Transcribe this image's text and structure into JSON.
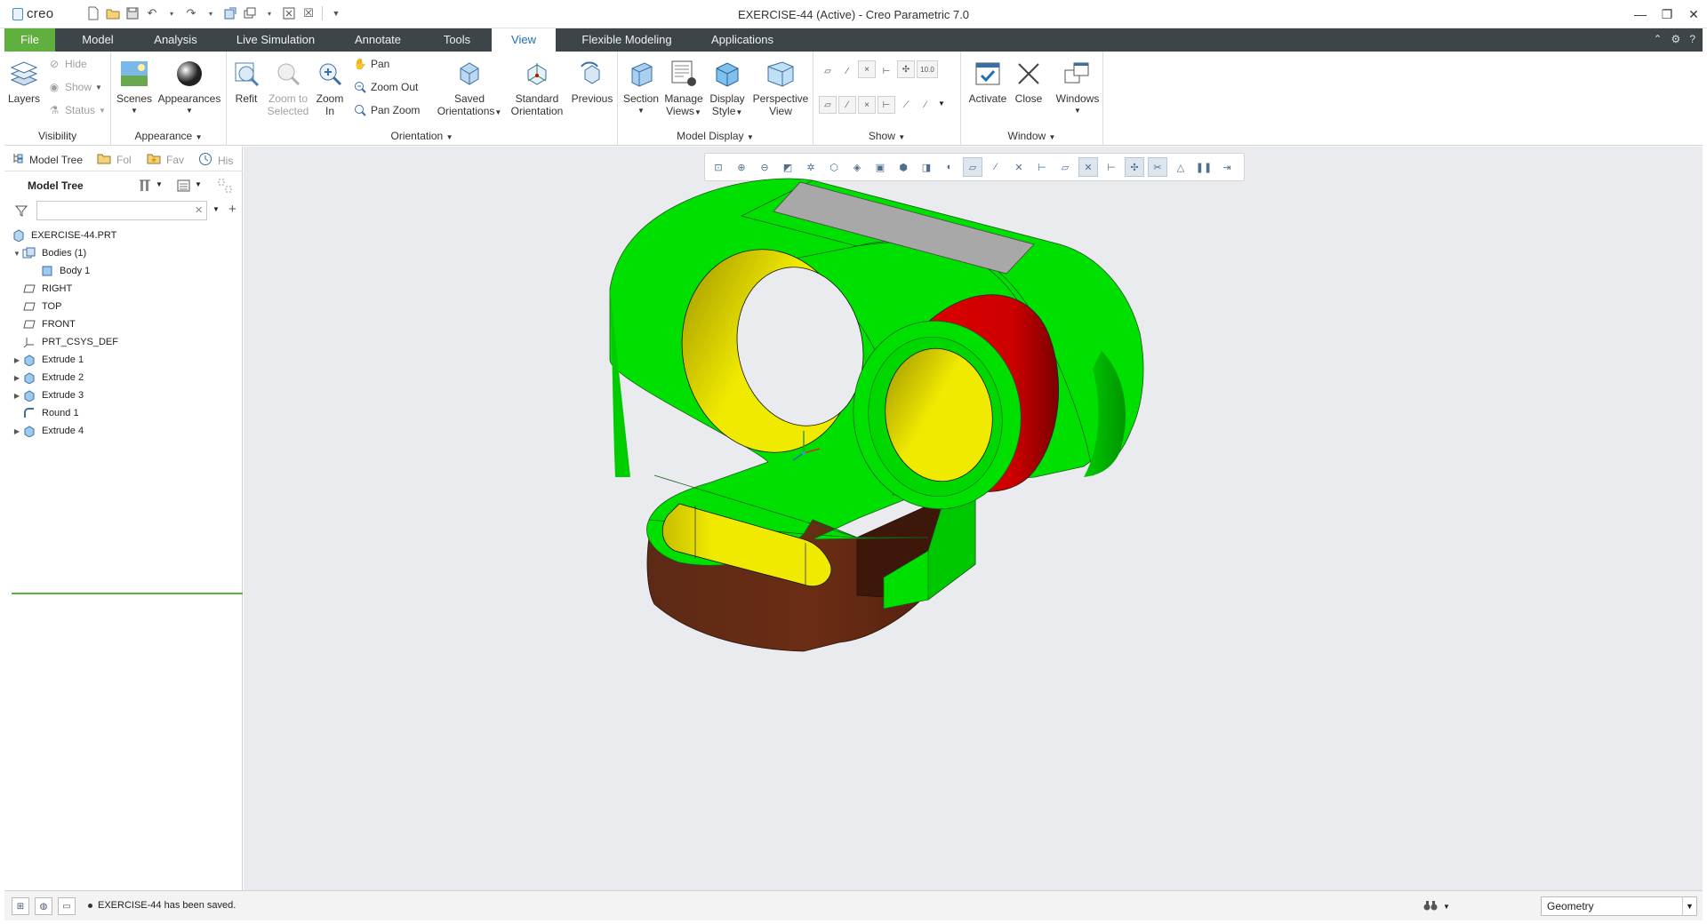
{
  "window": {
    "app_logo": "creo",
    "title": "EXERCISE-44 (Active) - Creo Parametric 7.0"
  },
  "tabs": [
    "File",
    "Model",
    "Analysis",
    "Live Simulation",
    "Annotate",
    "Tools",
    "View",
    "Flexible Modeling",
    "Applications"
  ],
  "active_tab": "View",
  "ribbon": {
    "visibility": {
      "group_label": "Visibility",
      "layers": "Layers",
      "hide": "Hide",
      "show": "Show",
      "status": "Status"
    },
    "appearance": {
      "group_label": "Appearance",
      "scenes": "Scenes",
      "appearances": "Appearances"
    },
    "orientation": {
      "group_label": "Orientation",
      "refit": "Refit",
      "zoom_to_selected_1": "Zoom to",
      "zoom_to_selected_2": "Selected",
      "zoom_in_1": "Zoom",
      "zoom_in_2": "In",
      "pan": "Pan",
      "zoom_out": "Zoom Out",
      "pan_zoom": "Pan Zoom",
      "saved_orientations_1": "Saved",
      "saved_orientations_2": "Orientations",
      "standard_orientation_1": "Standard",
      "standard_orientation_2": "Orientation",
      "previous": "Previous"
    },
    "model_display": {
      "group_label": "Model Display",
      "section": "Section",
      "manage_views_1": "Manage",
      "manage_views_2": "Views",
      "display_style_1": "Display",
      "display_style_2": "Style",
      "perspective_view_1": "Perspective",
      "perspective_view_2": "View"
    },
    "show": {
      "group_label": "Show"
    },
    "window": {
      "group_label": "Window",
      "activate": "Activate",
      "close": "Close",
      "windows": "Windows"
    }
  },
  "left_panel": {
    "tabs": [
      "Model Tree",
      "Fol",
      "Fav",
      "His"
    ],
    "tree_title": "Model Tree",
    "filter_value": "",
    "nodes": [
      {
        "label": "EXERCISE-44.PRT"
      },
      {
        "label": "Bodies (1)"
      },
      {
        "label": "Body 1"
      },
      {
        "label": "RIGHT"
      },
      {
        "label": "TOP"
      },
      {
        "label": "FRONT"
      },
      {
        "label": "PRT_CSYS_DEF"
      },
      {
        "label": "Extrude 1"
      },
      {
        "label": "Extrude 2"
      },
      {
        "label": "Extrude 3"
      },
      {
        "label": "Round 1"
      },
      {
        "label": "Extrude 4"
      }
    ]
  },
  "status": {
    "message": "EXERCISE-44 has been saved.",
    "filter": "Geometry"
  },
  "colors": {
    "accent_green": "#5fb03e",
    "tab_bar": "#3e4549",
    "model_green": "#00e000",
    "model_yellow": "#f0ea00",
    "model_red": "#e00000",
    "model_gray": "#a8a8a8",
    "model_brown": "#6b2a14",
    "viewport_bg": "#e9ebee"
  }
}
